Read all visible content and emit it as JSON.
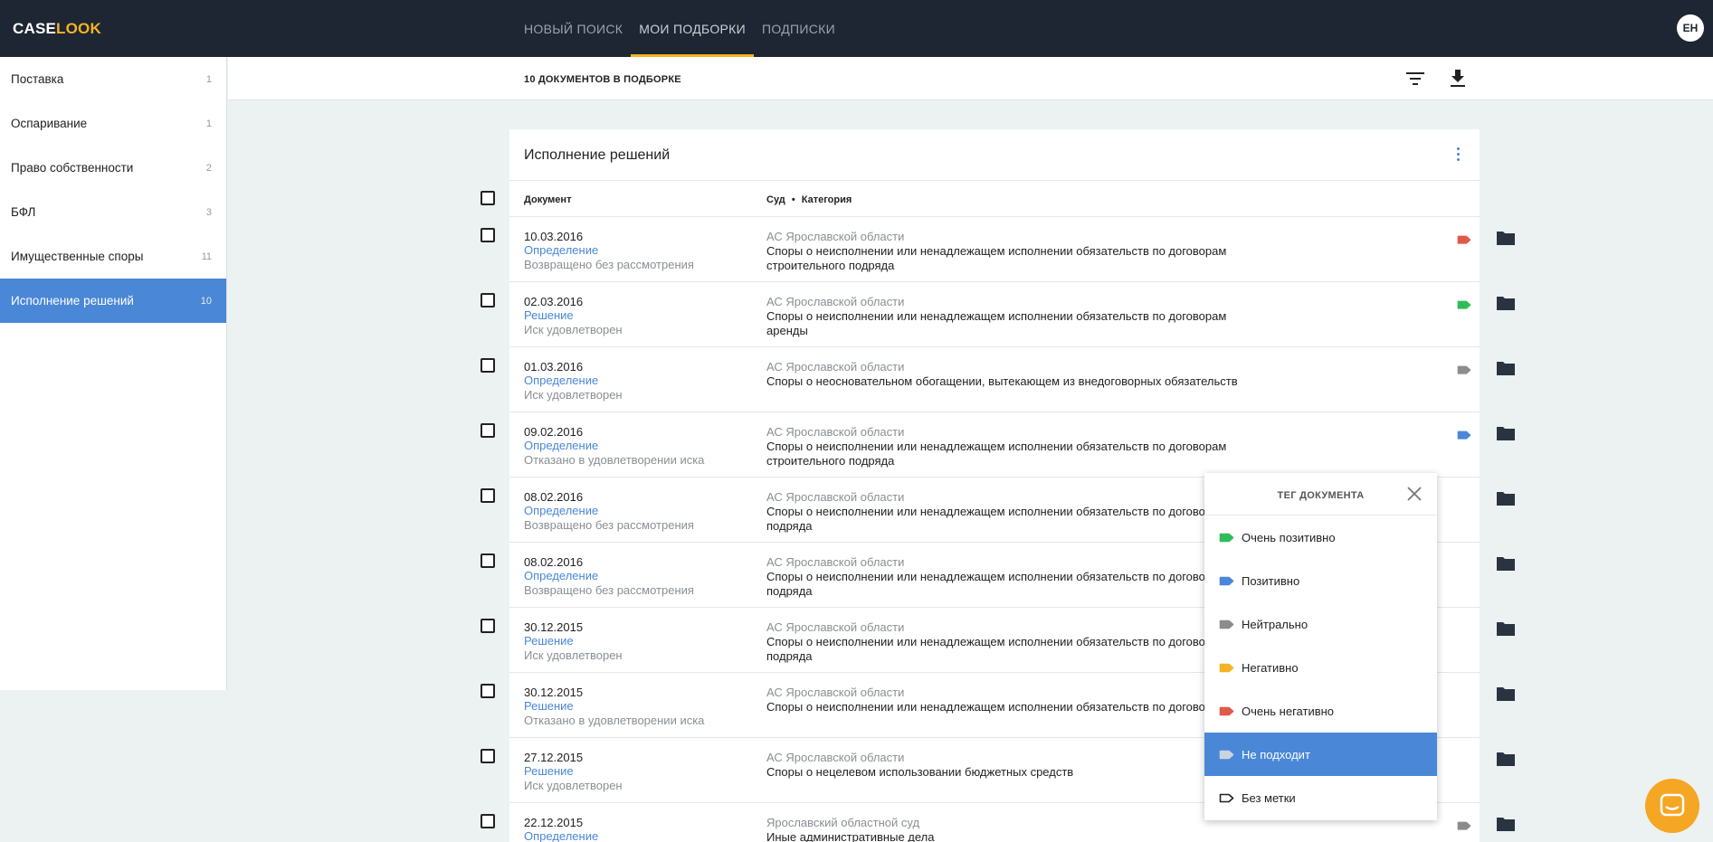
{
  "app": {
    "logo_part1": "CASE",
    "logo_part2": "LOOK"
  },
  "nav": [
    {
      "label": "НОВЫЙ ПОИСК"
    },
    {
      "label": "МОИ ПОДБОРКИ"
    },
    {
      "label": "ПОДПИСКИ"
    }
  ],
  "user": {
    "initials": "ЕН"
  },
  "sidebar": {
    "items": [
      {
        "label": "Поставка",
        "count": "1"
      },
      {
        "label": "Оспаривание",
        "count": "1"
      },
      {
        "label": "Право собственности",
        "count": "2"
      },
      {
        "label": "БФЛ",
        "count": "3"
      },
      {
        "label": "Имущественные споры",
        "count": "11"
      },
      {
        "label": "Исполнение решений",
        "count": "10"
      }
    ]
  },
  "subheader": {
    "count_label": "10 ДОКУМЕНТОВ В ПОДБОРКЕ"
  },
  "card": {
    "title": "Исполнение решений",
    "col_document": "Документ",
    "col_court": "Суд",
    "col_sep": "•",
    "col_category": "Категория"
  },
  "rows": [
    {
      "date": "10.03.2016",
      "type": "Определение",
      "result": "Возвращено без рассмотрения",
      "court": "АС Ярославской области",
      "category": "Споры о неисполнении или ненадлежащем исполнении обязательств по договорам строительного подряда",
      "tag_color": "#e05a4a"
    },
    {
      "date": "02.03.2016",
      "type": "Решение",
      "result": "Иск удовлетворен",
      "court": "АС Ярославской области",
      "category": "Споры о неисполнении или ненадлежащем исполнении обязательств по договорам аренды",
      "tag_color": "#2ebd59"
    },
    {
      "date": "01.03.2016",
      "type": "Определение",
      "result": "Иск удовлетворен",
      "court": "АС Ярославской области",
      "category": "Споры о неосновательном обогащении, вытекающем из внедоговорных обязательств",
      "tag_color": "#8c8c8c"
    },
    {
      "date": "09.02.2016",
      "type": "Определение",
      "result": "Отказано в удовлетворении иска",
      "court": "АС Ярославской области",
      "category": "Споры о неисполнении или ненадлежащем исполнении обязательств по договорам строительного подряда",
      "tag_color": "#4a87d6"
    },
    {
      "date": "08.02.2016",
      "type": "Определение",
      "result": "Возвращено без рассмотрения",
      "court": "АС Ярославской области",
      "category": "Споры о неисполнении или ненадлежащем исполнении обязательств по догово",
      "category2": "подряда",
      "tag_color": ""
    },
    {
      "date": "08.02.2016",
      "type": "Определение",
      "result": "Возвращено без рассмотрения",
      "court": "АС Ярославской области",
      "category": "Споры о неисполнении или ненадлежащем исполнении обязательств по догово",
      "category2": "подряда",
      "tag_color": ""
    },
    {
      "date": "30.12.2015",
      "type": "Решение",
      "result": "Иск удовлетворен",
      "court": "АС Ярославской области",
      "category": "Споры о неисполнении или ненадлежащем исполнении обязательств по догово",
      "category2": "подряда",
      "tag_color": ""
    },
    {
      "date": "30.12.2015",
      "type": "Решение",
      "result": "Отказано в удовлетворении иска",
      "court": "АС Ярославской области",
      "category": "Споры о неисполнении или ненадлежащем исполнении обязательств по догово",
      "tag_color": ""
    },
    {
      "date": "27.12.2015",
      "type": "Решение",
      "result": "Иск удовлетворен",
      "court": "АС Ярославской области",
      "category": "Споры о нецелевом использовании бюджетных средств",
      "tag_color": ""
    },
    {
      "date": "22.12.2015",
      "type": "Определение",
      "result": "",
      "court": "Ярославский областной суд",
      "category": "Иные административные дела",
      "tag_color": "#8c8c8c"
    }
  ],
  "tag_popup": {
    "title": "ТЕГ ДОКУМЕНТА",
    "options": [
      {
        "label": "Очень позитивно",
        "color": "#2ebd59"
      },
      {
        "label": "Позитивно",
        "color": "#4a87d6"
      },
      {
        "label": "Нейтрально",
        "color": "#8c8c8c"
      },
      {
        "label": "Негативно",
        "color": "#f5b324"
      },
      {
        "label": "Очень негативно",
        "color": "#e05a4a"
      },
      {
        "label": "Не подходит",
        "color": "#c8d4e0"
      },
      {
        "label": "Без метки",
        "color": ""
      }
    ]
  },
  "colors": {
    "accent": "#4a87d6",
    "brand": "#f5b324",
    "topbar": "#1d2632"
  }
}
